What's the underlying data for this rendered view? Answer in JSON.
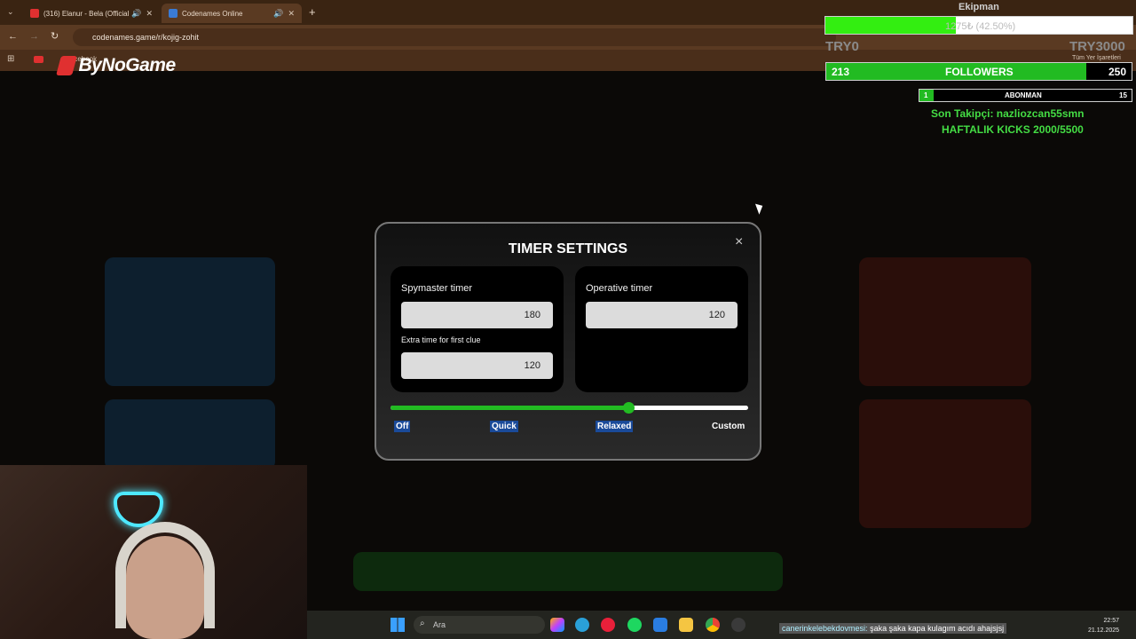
{
  "browser": {
    "tabs": [
      {
        "title": "(316) Elanur - Bela (Official",
        "color": "#e03030"
      },
      {
        "title": "Codenames Online",
        "color": "#3a7bd5"
      }
    ],
    "new_tab": "+",
    "url": "codenames.game/r/kojig-zohit",
    "bookmark": "Facebook",
    "all_bookmarks": "Tüm Yer İşaretleri"
  },
  "overlay": {
    "logo": "ByNoGame",
    "goal_title": "Ekipman",
    "goal_text": "1275₺ (42.50%)",
    "goal_progress": 0.425,
    "goal_min": "TRY0",
    "goal_max": "TRY3000",
    "followers": {
      "current": "213",
      "label": "FOLLOWERS",
      "target": "250",
      "progress": 0.852
    },
    "subs": {
      "current": "1",
      "label": "ABONMAN",
      "target": "15",
      "progress": 0.067
    },
    "last_follower": "Son Takipçi: nazliozcan55smn",
    "weekly_kicks": "HAFTALIK KICKS 2000/5500",
    "chat_user": "canerinkelebekdovmesi:",
    "chat_message": "şaka şaka kapa kulagım acıdı ahajsjsj"
  },
  "modal": {
    "title": "TIMER SETTINGS",
    "close": "×",
    "spymaster_label": "Spymaster timer",
    "spymaster_value": "180",
    "extra_label": "Extra time for first clue",
    "extra_value": "120",
    "operative_label": "Operative timer",
    "operative_value": "120",
    "slider_value": 0.665,
    "presets": [
      "Off",
      "Quick",
      "Relaxed",
      "Custom"
    ],
    "selected_preset": "Relaxed",
    "accent": "#22bb22"
  },
  "taskbar": {
    "search": "Ara",
    "time": "22:57",
    "date": "21.12.2025"
  }
}
